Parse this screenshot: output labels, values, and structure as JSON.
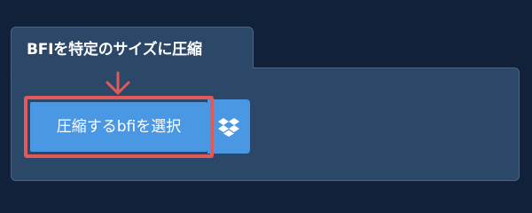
{
  "panel": {
    "tab_title": "BFIを特定のサイズに圧縮"
  },
  "actions": {
    "select_file_label": "圧縮するbfiを選択",
    "dropbox_icon": "dropbox-icon"
  },
  "annotation": {
    "arrow_icon": "arrow-down-icon",
    "highlight_color": "#e15a5a"
  },
  "colors": {
    "background": "#11213a",
    "panel": "#2c4868",
    "button": "#4a98e3",
    "text": "#ffffff"
  }
}
